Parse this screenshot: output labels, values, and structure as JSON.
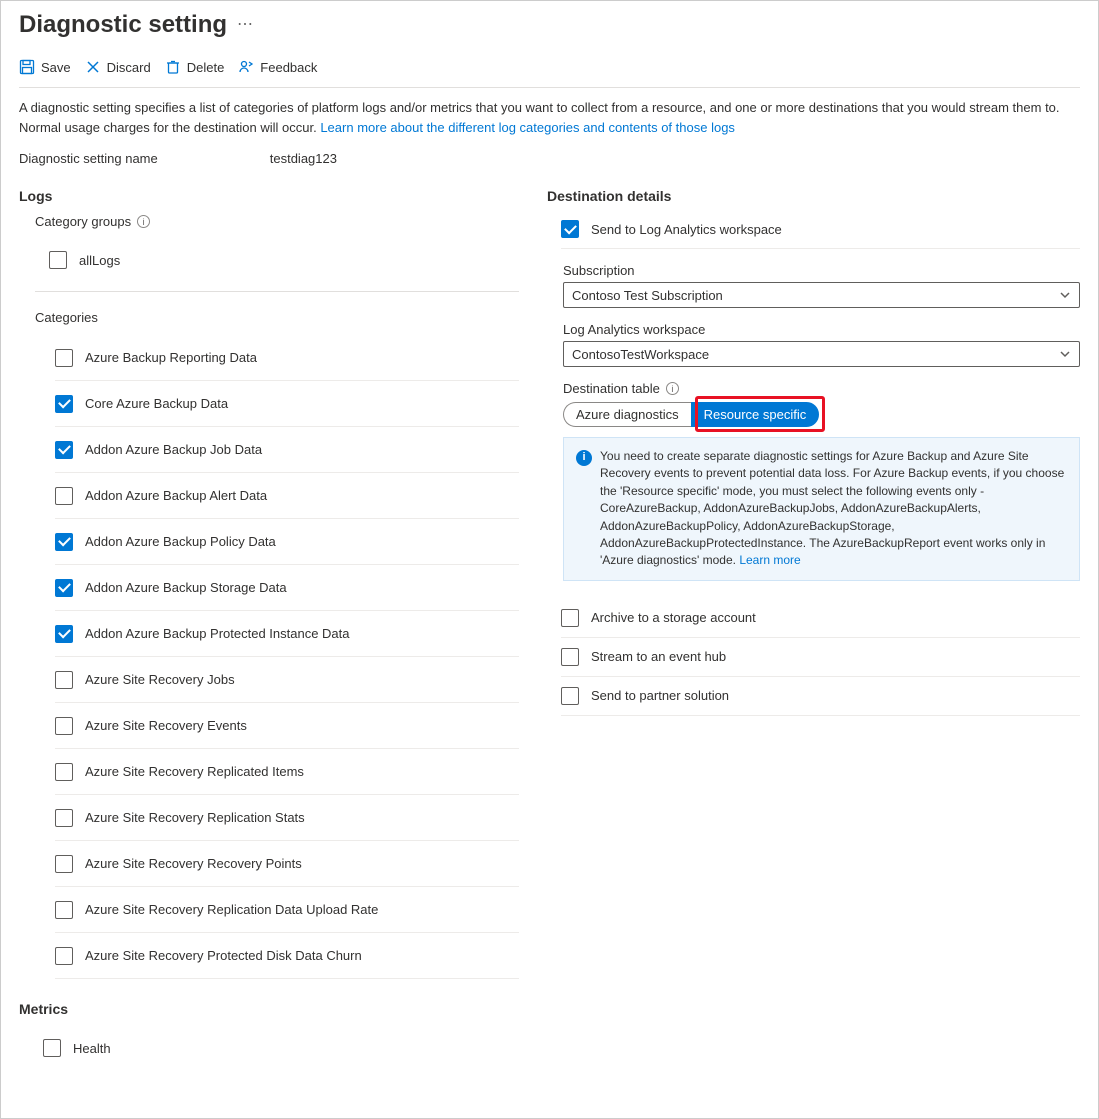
{
  "header": {
    "title": "Diagnostic setting"
  },
  "toolbar": {
    "save": "Save",
    "discard": "Discard",
    "delete": "Delete",
    "feedback": "Feedback"
  },
  "intro": {
    "text": "A diagnostic setting specifies a list of categories of platform logs and/or metrics that you want to collect from a resource, and one or more destinations that you would stream them to. Normal usage charges for the destination will occur. ",
    "link": "Learn more about the different log categories and contents of those logs"
  },
  "settingName": {
    "label": "Diagnostic setting name",
    "value": "testdiag123"
  },
  "logs": {
    "heading": "Logs",
    "categoryGroupsLabel": "Category groups",
    "allLogs": {
      "label": "allLogs",
      "checked": false
    },
    "categoriesLabel": "Categories",
    "categories": [
      {
        "label": "Azure Backup Reporting Data",
        "checked": false
      },
      {
        "label": "Core Azure Backup Data",
        "checked": true
      },
      {
        "label": "Addon Azure Backup Job Data",
        "checked": true
      },
      {
        "label": "Addon Azure Backup Alert Data",
        "checked": false
      },
      {
        "label": "Addon Azure Backup Policy Data",
        "checked": true
      },
      {
        "label": "Addon Azure Backup Storage Data",
        "checked": true
      },
      {
        "label": "Addon Azure Backup Protected Instance Data",
        "checked": true
      },
      {
        "label": "Azure Site Recovery Jobs",
        "checked": false
      },
      {
        "label": "Azure Site Recovery Events",
        "checked": false
      },
      {
        "label": "Azure Site Recovery Replicated Items",
        "checked": false
      },
      {
        "label": "Azure Site Recovery Replication Stats",
        "checked": false
      },
      {
        "label": "Azure Site Recovery Recovery Points",
        "checked": false
      },
      {
        "label": "Azure Site Recovery Replication Data Upload Rate",
        "checked": false
      },
      {
        "label": "Azure Site Recovery Protected Disk Data Churn",
        "checked": false
      }
    ]
  },
  "metrics": {
    "heading": "Metrics",
    "items": [
      {
        "label": "Health",
        "checked": false
      }
    ]
  },
  "destination": {
    "heading": "Destination details",
    "sendLA": {
      "label": "Send to Log Analytics workspace",
      "checked": true
    },
    "subscription": {
      "label": "Subscription",
      "value": "Contoso Test Subscription"
    },
    "workspace": {
      "label": "Log Analytics workspace",
      "value": "ContosoTestWorkspace"
    },
    "destTable": {
      "label": "Destination table",
      "option1": "Azure diagnostics",
      "option2": "Resource specific",
      "selected": "Resource specific"
    },
    "info": {
      "text": "You need to create separate diagnostic settings for Azure Backup and Azure Site Recovery events to prevent potential data loss. For Azure Backup events, if you choose the 'Resource specific' mode, you must select the following events only - CoreAzureBackup, AddonAzureBackupJobs, AddonAzureBackupAlerts, AddonAzureBackupPolicy, AddonAzureBackupStorage, AddonAzureBackupProtectedInstance. The AzureBackupReport event works only in 'Azure diagnostics' mode.  ",
      "link": "Learn more"
    },
    "archive": {
      "label": "Archive to a storage account",
      "checked": false
    },
    "eventhub": {
      "label": "Stream to an event hub",
      "checked": false
    },
    "partner": {
      "label": "Send to partner solution",
      "checked": false
    }
  }
}
